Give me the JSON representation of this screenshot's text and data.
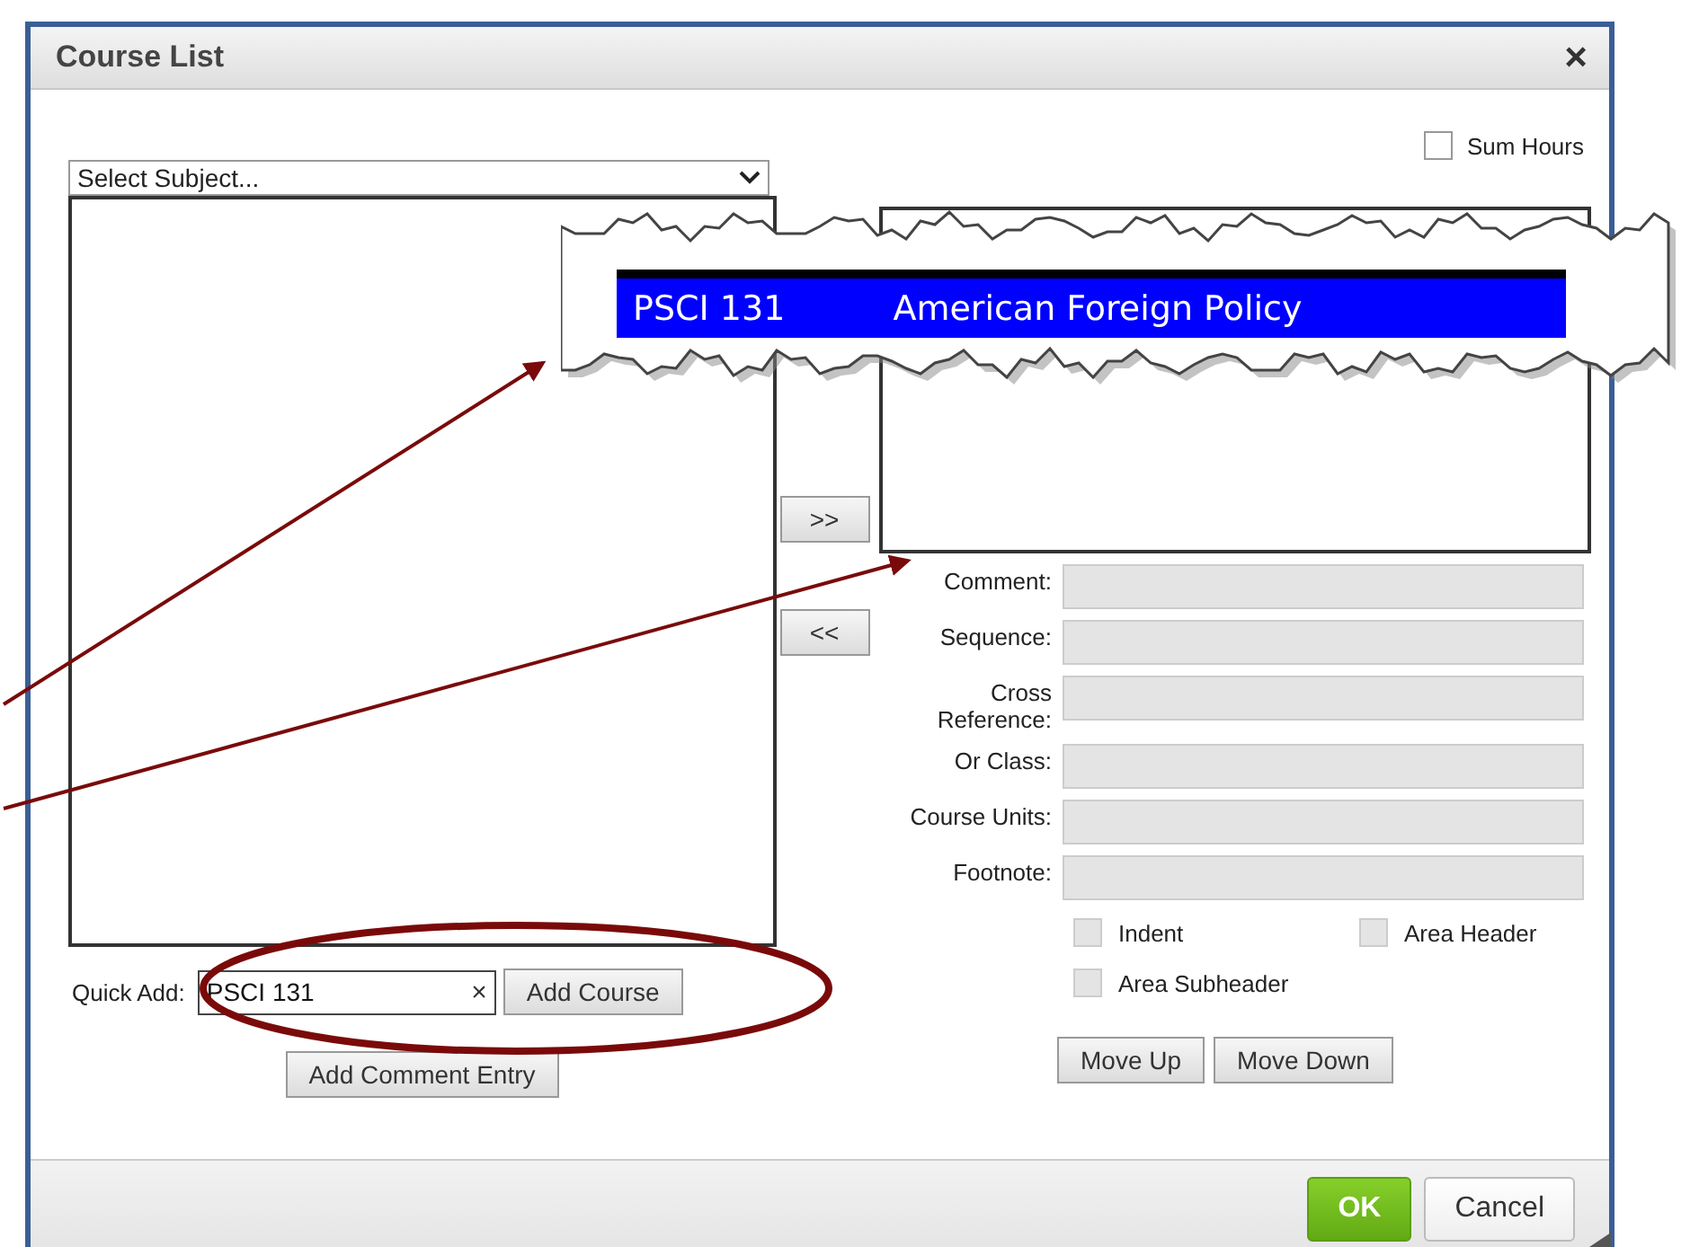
{
  "window": {
    "title": "Course List",
    "close": "×"
  },
  "sum_hours": {
    "label": "Sum Hours",
    "checked": false
  },
  "subject_select": {
    "placeholder": "Select Subject..."
  },
  "move_buttons": [
    ">>",
    "<<"
  ],
  "fields": [
    {
      "label": "Comment:"
    },
    {
      "label": "Sequence:"
    },
    {
      "label": "Cross Reference:"
    },
    {
      "label": "Or Class:"
    },
    {
      "label": "Course Units:"
    },
    {
      "label": "Footnote:"
    }
  ],
  "options": [
    {
      "label": "Indent",
      "checked": false
    },
    {
      "label": "Area Header",
      "checked": false
    },
    {
      "label": "Area Subheader",
      "checked": false
    }
  ],
  "order_buttons": [
    "Move Up",
    "Move Down"
  ],
  "quick_add": {
    "label": "Quick Add:",
    "value": "PSCI 131",
    "clear": "×",
    "button": "Add Course"
  },
  "comment_button": "Add Comment Entry",
  "footer_buttons": [
    {
      "label": "OK",
      "kind": "primary"
    },
    {
      "label": "Cancel",
      "kind": "secondary"
    }
  ],
  "callout": {
    "code": "PSCI 131",
    "title": "American Foreign Policy"
  }
}
